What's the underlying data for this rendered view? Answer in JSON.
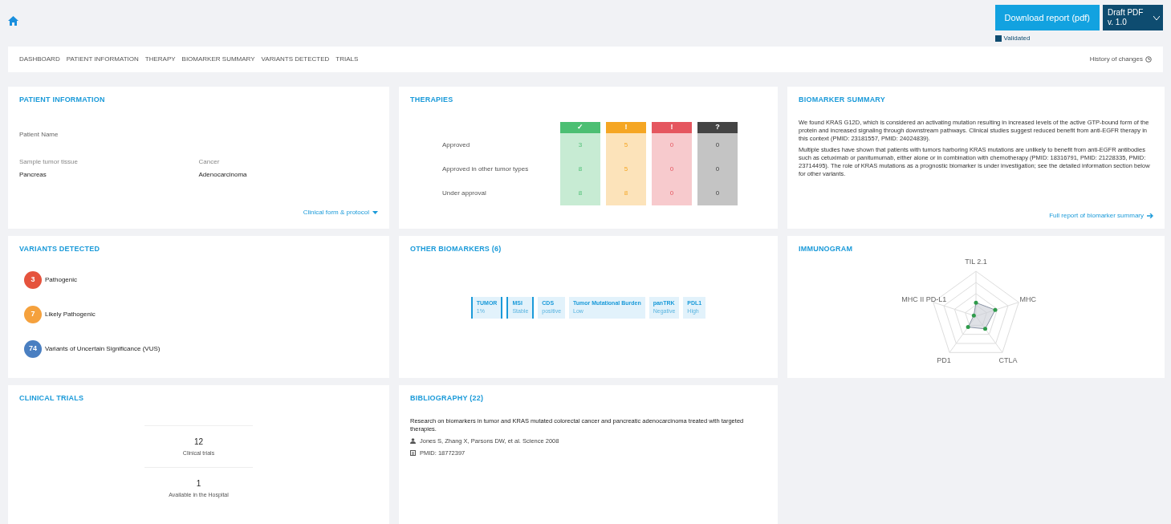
{
  "breadcrumb": [
    "DASHBOARD",
    "PATIENT INFORMATION",
    "THERAPY",
    "BIOMARKER SUMMARY",
    "VARIANTS DETECTED",
    "TRIALS"
  ],
  "history_link": "History of changes",
  "download_button": "Download report (pdf)",
  "status_button": {
    "line1": "Draft PDF",
    "line2": "v. 1.0"
  },
  "validated": {
    "label": "Validated",
    "checked": true
  },
  "patient": {
    "title": "PATIENT INFORMATION",
    "name_label": "Patient Name",
    "fields": [
      {
        "label": "Sample tumor tissue",
        "value": "Pancreas"
      },
      {
        "label": "Cancer",
        "value": "Adenocarcinoma"
      }
    ],
    "link": "Clinical form & protocol"
  },
  "therapies": {
    "title": "THERAPIES",
    "columns": [
      {
        "icon": "✓",
        "color": "#4cbf73"
      },
      {
        "icon": "!",
        "color": "#f5a623"
      },
      {
        "icon": "!",
        "color": "#e5565f"
      },
      {
        "icon": "?",
        "color": "#444444"
      }
    ],
    "rows": [
      {
        "label": "Approved",
        "values": [
          "3",
          "5",
          "0",
          "0"
        ]
      },
      {
        "label": "Approved in other tumor types",
        "values": [
          "8",
          "5",
          "0",
          "0"
        ]
      },
      {
        "label": "Under approval",
        "values": [
          "8",
          "8",
          "0",
          "0"
        ]
      }
    ]
  },
  "biomarker_summary": {
    "title": "BIOMARKER SUMMARY",
    "paragraphs": [
      "We found KRAS G12D, which is considered an activating mutation resulting in increased levels of the active GTP-bound form of the protein and increased signaling through downstream pathways. Clinical studies suggest reduced benefit from anti-EGFR therapy in this context (PMID: 23181557, PMID: 24024839).",
      "Multiple studies have shown that patients with tumors harboring KRAS mutations are unlikely to benefit from anti-EGFR antibodies such as cetuximab or panitumumab, either alone or in combination with chemotherapy (PMID: 18316791, PMID: 21228335, PMID: 23714495). The role of KRAS mutations as a prognostic biomarker is under investigation; see the detailed information section below for other variants."
    ],
    "link": "Full report of biomarker summary"
  },
  "variants": {
    "title": "VARIANTS DETECTED",
    "items": [
      {
        "count": "3",
        "label": "Pathogenic",
        "color": "#e5533d"
      },
      {
        "count": "7",
        "label": "Likely Pathogenic",
        "color": "#f5a13d"
      },
      {
        "count": "74",
        "label": "Variants of Uncertain Significance (VUS)",
        "color": "#4a7fc1"
      }
    ]
  },
  "other_biomarkers": {
    "title": "OTHER BIOMARKERS (6)",
    "chips": [
      {
        "name": "TUMOR",
        "value": "1%"
      },
      {
        "name": "MSI",
        "value": "Stable"
      },
      {
        "name": "CDS",
        "value": "positive"
      },
      {
        "name": "Tumor Mutational Burden",
        "value": "Low"
      },
      {
        "name": "panTRK",
        "value": "Negative"
      },
      {
        "name": "PDL1",
        "value": "High"
      }
    ]
  },
  "immunogram": {
    "title": "IMMUNOGRAM",
    "axes": [
      {
        "label": "TIL",
        "sub": "2.1"
      },
      {
        "label": "MHC"
      },
      {
        "label": "CTLA"
      },
      {
        "label": "PD1"
      },
      {
        "label": "MHC II",
        "sub": "PD-L1"
      }
    ]
  },
  "clinical_trials": {
    "title": "CLINICAL TRIALS",
    "stats": [
      {
        "value": "12",
        "label": "Clinical trials"
      },
      {
        "value": "1",
        "label": "Available in the Hospital"
      }
    ]
  },
  "bibliography": {
    "title": "BIBLIOGRAPHY (22)",
    "text": "Research on biomarkers in tumor and KRAS mutated colorectal cancer and pancreatic adenocarcinoma treated with targeted therapies.",
    "items": [
      "Jones S, Zhang X, Parsons DW, et al. Science 2008",
      "PMID: 18772397"
    ]
  }
}
